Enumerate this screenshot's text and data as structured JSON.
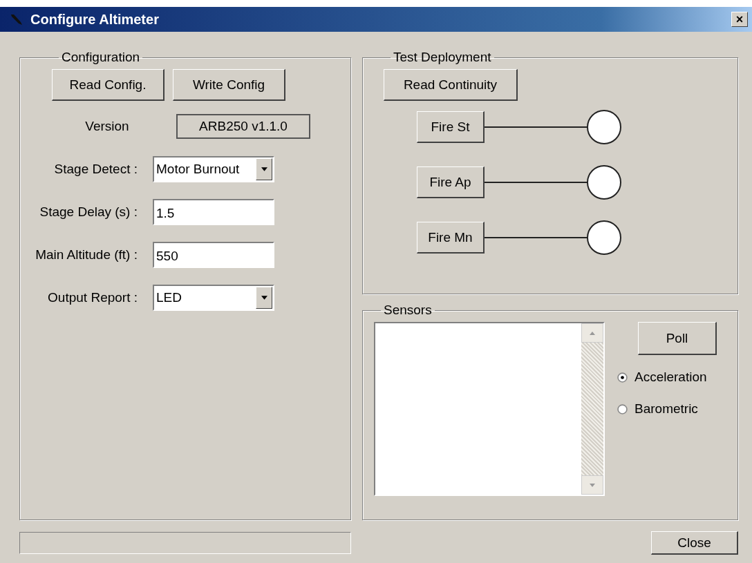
{
  "window": {
    "title": "Configure Altimeter",
    "close": "×"
  },
  "configuration": {
    "title": "Configuration",
    "buttons": [
      "Read Config.",
      "Write Config"
    ],
    "fields": [
      {
        "kind": "readonly",
        "label": "Version",
        "value": "ARB250 v1.1.0"
      },
      {
        "kind": "dropdown",
        "label": "Stage Detect :",
        "value": "Motor Burnout"
      },
      {
        "kind": "input",
        "label": "Stage Delay (s) :",
        "value": "1.5"
      },
      {
        "kind": "input",
        "label": "Main Altitude (ft) :",
        "value": "550"
      },
      {
        "kind": "dropdown",
        "label": "Output Report :",
        "value": "LED"
      }
    ]
  },
  "test_deployment": {
    "title": "Test Deployment",
    "button": "Read Continuity",
    "channels": [
      {
        "label": "Fire St"
      },
      {
        "label": "Fire Ap"
      },
      {
        "label": "Fire Mn"
      }
    ]
  },
  "sensors": {
    "title": "Sensors",
    "button": "Poll",
    "modes": [
      {
        "label": "Acceleration",
        "selected": true
      },
      {
        "label": "Barometric",
        "selected": false
      }
    ]
  },
  "footer": {
    "button": "Close"
  }
}
